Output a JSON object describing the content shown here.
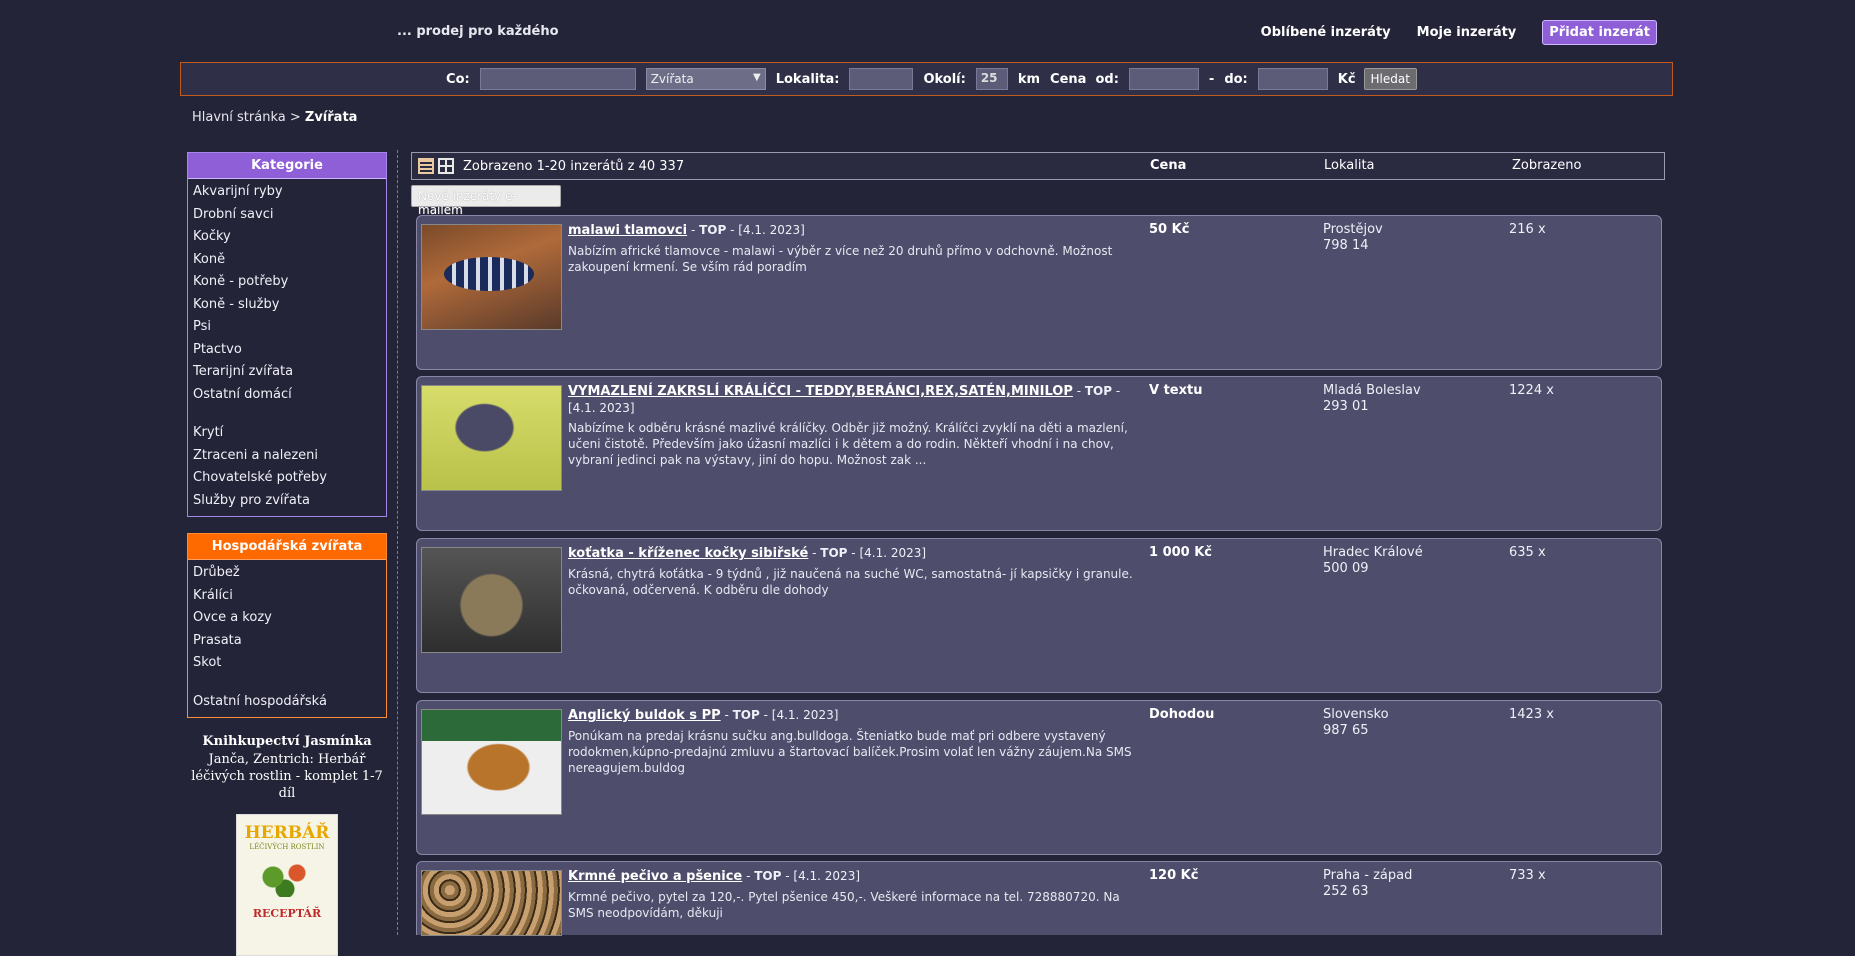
{
  "header": {
    "slogan": "... prodej pro každého",
    "links": [
      "Oblíbené inzeráty",
      "Moje inzeráty"
    ],
    "add_button": "Přidat inzerát"
  },
  "search": {
    "what_label": "Co:",
    "what_value": "",
    "category_selected": "Zvířata",
    "location_label": "Lokalita:",
    "location_value": "",
    "radius_label": "Okolí:",
    "radius_value": "25",
    "radius_unit": "km",
    "price_from_label": "Cena  od:",
    "price_from_value": "",
    "dash": "-",
    "price_to_label": "do:",
    "price_to_value": "",
    "currency": "Kč",
    "submit_label": "Hledat"
  },
  "breadcrumb": {
    "home": "Hlavní stránka",
    "separator": ">",
    "current": "Zvířata"
  },
  "sidebar": {
    "categories_title": "Kategorie",
    "categories": [
      "Akvarijní ryby",
      "Drobní savci",
      "Kočky",
      "Koně",
      "Koně - potřeby",
      "Koně - služby",
      "Psi",
      "Ptactvo",
      "Terarijní zvířata",
      "Ostatní domácí",
      "",
      "Krytí",
      "Ztraceni a nalezeni",
      "Chovatelské potřeby",
      "Služby pro zvířata"
    ],
    "farm_title": "Hospodářská zvířata",
    "farm": [
      "Drůbež",
      "Králíci",
      "Ovce a kozy",
      "Prasata",
      "Skot",
      "",
      "Ostatní hospodářská"
    ],
    "promo_title": "Knihkupectví Jasmínka",
    "promo_text": "Janča, Zentrich: Herbář léčivých rostlin - komplet 1-7 díl",
    "book_title": "HERBÁŘ",
    "book_subtitle": "LÉČIVÝCH ROSTLIN",
    "book_bottom": "RECEPTÁŘ"
  },
  "listing": {
    "count_text": "Zobrazeno 1-20 inzerátů z 40 337",
    "col_price": "Cena",
    "col_location": "Lokalita",
    "col_views": "Zobrazeno",
    "email_button": "Nové inzeráty e-mailem",
    "ads": [
      {
        "title": "malawi tlamovci",
        "tag": "TOP",
        "date": "[4.1. 2023]",
        "desc": "Nabízím africké tlamovce - malawi - výběr z více než 20 druhů přímo v odchovně. Možnost zakoupení krmení. Se vším rád poradím",
        "price": "50 Kč",
        "city": "Prostějov",
        "zip": "798 14",
        "views": "216 x"
      },
      {
        "title": "VYMAZLENÍ ZAKRSLÍ KRÁLÍČCI - TEDDY,BERÁNCI,REX,SATÉN,MINILOP",
        "tag": "TOP",
        "date": "[4.1. 2023]",
        "desc": "Nabízíme k odběru krásné mazlivé králíčky. Odběr již možný. Králíčci zvyklí na děti a mazlení, učeni čistotě. Především jako úžasní mazlíci i k dětem a do rodin. Někteří vhodní i na chov, vybraní jedinci pak na výstavy, jiní do hopu. Možnost zak ...",
        "price": "V textu",
        "city": "Mladá Boleslav",
        "zip": "293 01",
        "views": "1224 x"
      },
      {
        "title": "koťatka - kříženec kočky sibiřské",
        "tag": "TOP",
        "date": "[4.1. 2023]",
        "desc": "Krásná, chytrá koťátka - 9 týdnů , již naučená na suché WC, samostatná- jí kapsičky i granule. očkovaná, odčervená. K odběru dle dohody",
        "price": "1 000 Kč",
        "city": "Hradec Králové",
        "zip": "500 09",
        "views": "635 x"
      },
      {
        "title": "Anglický buldok s PP",
        "tag": "TOP",
        "date": "[4.1. 2023]",
        "desc": "Ponúkam na predaj krásnu sučku ang.bulldoga. Šteniatko bude mať pri odbere vystavený rodokmen,kúpno-predajnú zmluvu a štartovací balíček.Prosim volať len vážny záujem.Na SMS nereagujem.buldog",
        "price": "Dohodou",
        "city": "Slovensko",
        "zip": "987 65",
        "views": "1423 x"
      },
      {
        "title": "Krmné pečivo a pšenice",
        "tag": "TOP",
        "date": "[4.1. 2023]",
        "desc": "Krmné pečivo, pytel za 120,-. Pytel pšenice 450,-. Veškeré informace na tel. 728880720. Na SMS neodpovídám, děkuji",
        "price": "120 Kč",
        "city": "Praha - západ",
        "zip": "252 63",
        "views": "733 x"
      }
    ]
  }
}
